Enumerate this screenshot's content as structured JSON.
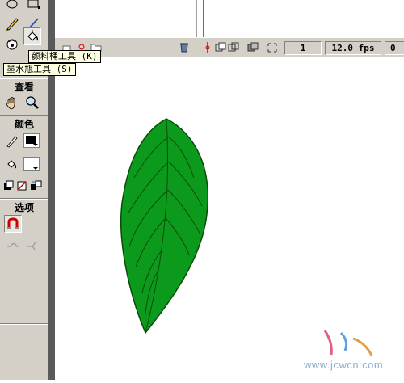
{
  "toolbar": {
    "view_label": "查看",
    "colors_label": "颜色",
    "options_label": "选项"
  },
  "tooltips": {
    "paint_bucket": "颜料桶工具 (K)",
    "ink_bottle": "墨水瓶工具 (S)"
  },
  "timeline": {
    "current_frame": "1",
    "frame_rate": "12.0 fps",
    "elapsed": "0"
  },
  "colors": {
    "leaf_fill": "#0c9a1c",
    "leaf_stroke": "#0a4d0a",
    "playhead": "#cc0000",
    "stroke_swatch": "#000000",
    "fill_swatch": "#ffffff"
  },
  "watermark": "www.jcwcn.com"
}
